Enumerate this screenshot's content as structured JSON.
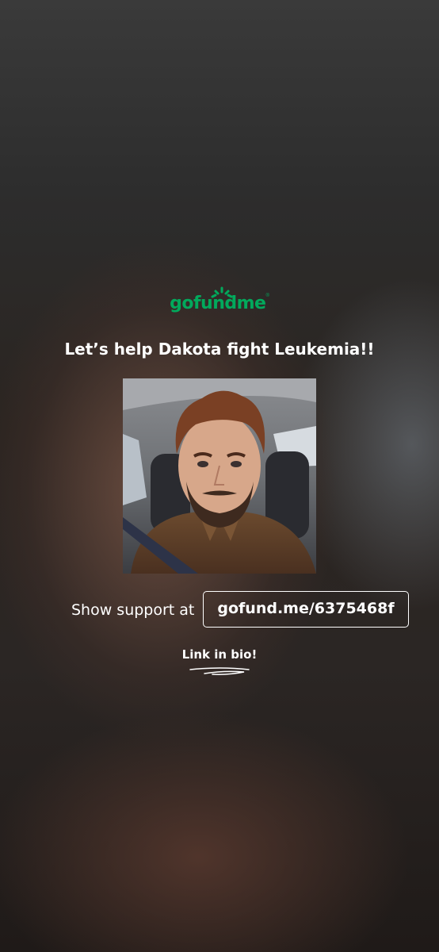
{
  "logo": {
    "text": "gofundme",
    "trademark": "®"
  },
  "headline": "Let’s help Dakota fight Leukemia!!",
  "photo": {
    "subject": "selfie-in-car"
  },
  "support": {
    "label": "Show support at",
    "link": "gofund.me/6375468f"
  },
  "bio_link": "Link in bio!",
  "colors": {
    "brand_green": "#02a95c",
    "text": "#ffffff"
  }
}
